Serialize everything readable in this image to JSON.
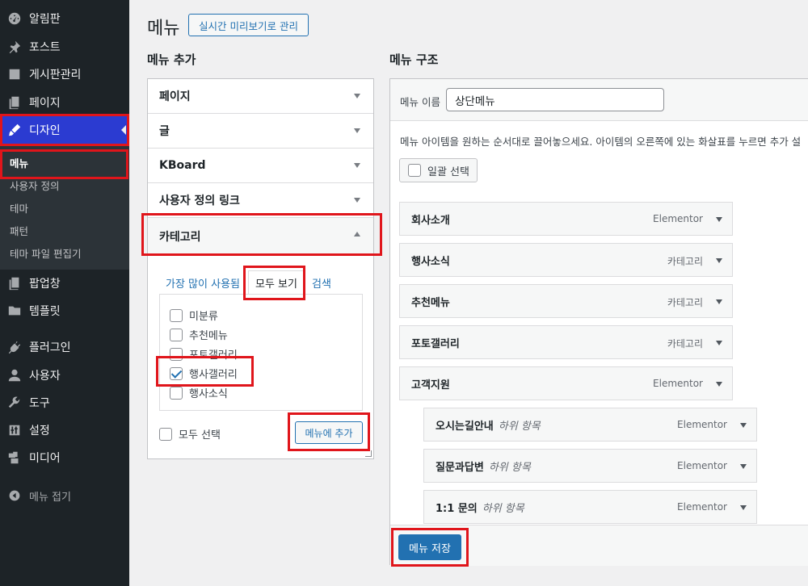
{
  "sidebar": {
    "items": [
      {
        "label": "알림판",
        "icon": "dashboard-icon"
      },
      {
        "label": "포스트",
        "icon": "pin-icon"
      },
      {
        "label": "게시판관리",
        "icon": "board-icon"
      },
      {
        "label": "페이지",
        "icon": "pages-icon"
      },
      {
        "label": "디자인",
        "icon": "brush-icon"
      },
      {
        "label": "팝업창",
        "icon": "popup-icon"
      },
      {
        "label": "템플릿",
        "icon": "folder-icon"
      },
      {
        "label": "플러그인",
        "icon": "plugin-icon"
      },
      {
        "label": "사용자",
        "icon": "user-icon"
      },
      {
        "label": "도구",
        "icon": "wrench-icon"
      },
      {
        "label": "설정",
        "icon": "settings-icon"
      },
      {
        "label": "미디어",
        "icon": "media-icon"
      }
    ],
    "submenu": [
      "메뉴",
      "사용자 정의",
      "테마",
      "패턴",
      "테마 파일 편집기"
    ],
    "collapse_label": "메뉴 접기"
  },
  "header": {
    "title": "메뉴",
    "live_preview_label": "실시간 미리보기로 관리"
  },
  "add_menu": {
    "title": "메뉴 추가",
    "sections": [
      "페이지",
      "글",
      "KBoard",
      "사용자 정의 링크",
      "카테고리"
    ],
    "tabs": [
      "가장 많이 사용됨",
      "모두 보기",
      "검색"
    ],
    "categories": [
      {
        "label": "미분류",
        "checked": false
      },
      {
        "label": "추천메뉴",
        "checked": false
      },
      {
        "label": "포토갤러리",
        "checked": false
      },
      {
        "label": "행사갤러리",
        "checked": true
      },
      {
        "label": "행사소식",
        "checked": false
      }
    ],
    "select_all_label": "모두 선택",
    "add_button_label": "메뉴에 추가"
  },
  "structure": {
    "title": "메뉴 구조",
    "menu_name_label": "메뉴 이름",
    "menu_name_value": "상단메뉴",
    "instructions": "메뉴 아이템을 원하는 순서대로 끌어놓으세요. 아이템의 오른쪽에 있는 화살표를 누르면 추가 설",
    "bulk_select_label": "일괄 선택",
    "items": [
      {
        "title": "회사소개",
        "type": "Elementor",
        "sub": ""
      },
      {
        "title": "행사소식",
        "type": "카테고리",
        "sub": ""
      },
      {
        "title": "추천메뉴",
        "type": "카테고리",
        "sub": ""
      },
      {
        "title": "포토갤러리",
        "type": "카테고리",
        "sub": ""
      },
      {
        "title": "고객지원",
        "type": "Elementor",
        "sub": ""
      },
      {
        "title": "오시는길안내",
        "type": "Elementor",
        "sub": "하위 항목"
      },
      {
        "title": "질문과답변",
        "type": "Elementor",
        "sub": "하위 항목"
      },
      {
        "title": "1:1 문의",
        "type": "Elementor",
        "sub": "하위 항목"
      }
    ],
    "save_button_label": "메뉴 저장"
  },
  "colors": {
    "sidebar_bg": "#1d2327",
    "active_menu": "#2b3bd1",
    "primary": "#2271b1",
    "highlight": "#e0151b"
  }
}
